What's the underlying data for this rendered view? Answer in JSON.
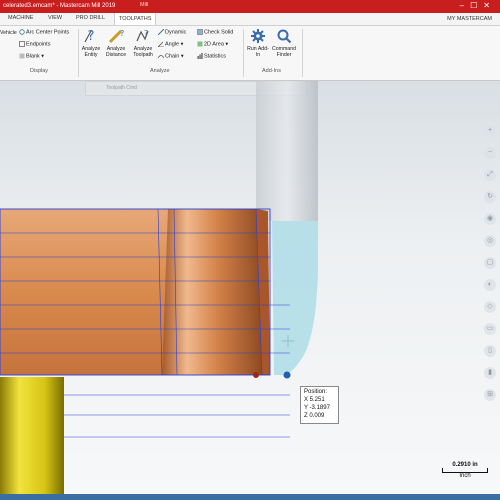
{
  "window": {
    "title": "celerated3.emcam* - Mastercam Mill 2019",
    "context_tab": "Mill"
  },
  "tabs": [
    {
      "label": "MACHINE"
    },
    {
      "label": "VIEW"
    },
    {
      "label": "PRO DRILL"
    },
    {
      "label": "TOOLPATHS"
    }
  ],
  "account": "MY MASTERCAM",
  "ribbon": {
    "display": {
      "name": "Display",
      "partial_button": "Vehicle",
      "items": [
        "Arc Center Points",
        "Endpoints",
        "Blank"
      ]
    },
    "analyze": {
      "name": "Analyze",
      "big_buttons": [
        {
          "label": "Analyze Entity"
        },
        {
          "label": "Analyze Distance"
        },
        {
          "label": "Analyze Toolpath"
        }
      ],
      "col1": [
        "Dynamic",
        "Angle",
        "Chain"
      ],
      "col2": [
        "Check Solid",
        "2D Area",
        "Statistics"
      ]
    },
    "addins": {
      "name": "Add-Ins",
      "buttons": [
        {
          "label": "Run Add-In"
        },
        {
          "label": "Command Finder"
        }
      ]
    }
  },
  "qat": {
    "field": "Toolpath Cmd"
  },
  "position": {
    "title": "Position:",
    "x": "X 5.251",
    "y": "Y -3.1897",
    "z": "Z 0.009"
  },
  "scale": {
    "value": "0.2910 in",
    "unit": "Inch"
  },
  "colors": {
    "title_red": "#c81e1e",
    "copper": "#d98a4d",
    "tool_blue": "#a9dbe6",
    "path_blue": "#2a3ed6",
    "yellow": "#d6c515"
  }
}
